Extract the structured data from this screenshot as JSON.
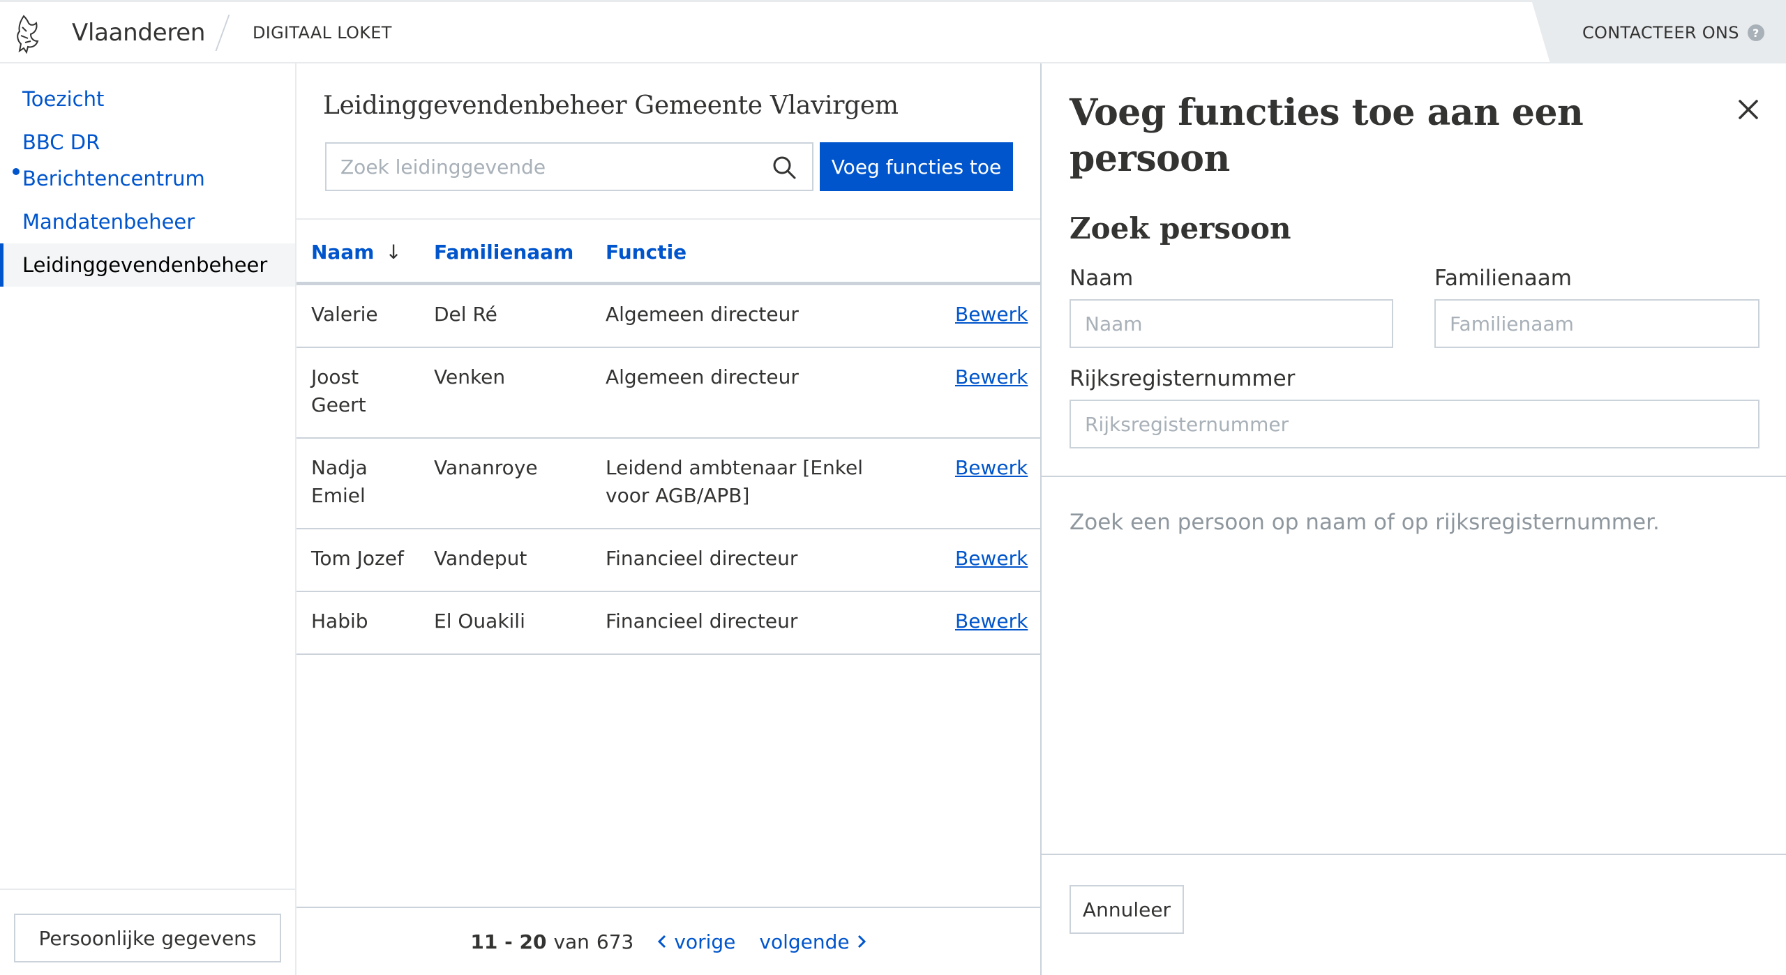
{
  "header": {
    "brand": "Vlaanderen",
    "loket": "DIGITAAL LOKET",
    "contact": "CONTACTEER ONS",
    "help_icon": "?"
  },
  "sidebar": {
    "items": [
      {
        "label": "Toezicht"
      },
      {
        "label": "BBC DR"
      },
      {
        "label": "Berichtencentrum"
      },
      {
        "label": "Mandatenbeheer"
      },
      {
        "label": "Leidinggevendenbeheer"
      }
    ],
    "footer_button": "Persoonlijke gegevens"
  },
  "main": {
    "title": "Leidinggevendenbeheer Gemeente Vlavirgem",
    "search_placeholder": "Zoek leidinggevende",
    "add_button": "Voeg functies toe",
    "columns": [
      "Naam",
      "Familienaam",
      "Functie"
    ],
    "sort_arrow": "↓",
    "rows": [
      {
        "naam": "Valerie",
        "familienaam": "Del Ré",
        "functie": "Algemeen directeur",
        "action": "Bewerk"
      },
      {
        "naam": "Joost Geert",
        "familienaam": "Venken",
        "functie": "Algemeen directeur",
        "action": "Bewerk"
      },
      {
        "naam": "Nadja Emiel",
        "familienaam": "Vananroye",
        "functie": "Leidend ambtenaar [Enkel voor AGB/APB]",
        "action": "Bewerk"
      },
      {
        "naam": "Tom Jozef",
        "familienaam": "Vandeput",
        "functie": "Financieel directeur",
        "action": "Bewerk"
      },
      {
        "naam": "Habib",
        "familienaam": "El Ouakili",
        "functie": "Financieel directeur",
        "action": "Bewerk"
      }
    ],
    "pager": {
      "range": "11 - 20",
      "of": "van",
      "total": "673",
      "prev": "vorige",
      "next": "volgende"
    }
  },
  "panel": {
    "title": "Voeg functies toe aan een persoon",
    "subtitle": "Zoek persoon",
    "naam_label": "Naam",
    "naam_placeholder": "Naam",
    "familienaam_label": "Familienaam",
    "familienaam_placeholder": "Familienaam",
    "rrn_label": "Rijksregisternummer",
    "rrn_placeholder": "Rijksregisternummer",
    "hint": "Zoek een persoon op naam of op rijksregisternummer.",
    "cancel_button": "Annuleer"
  },
  "colors": {
    "primary": "#0055cc",
    "text": "#333332",
    "border": "#cbd2da",
    "muted": "#a8b0b8"
  }
}
